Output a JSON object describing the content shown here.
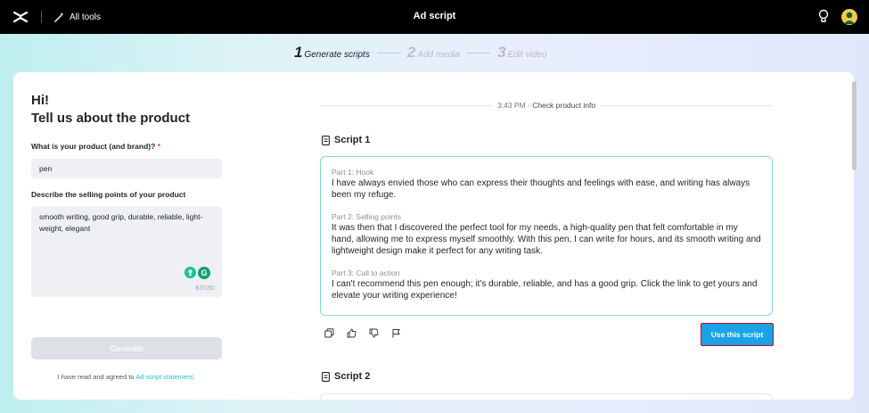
{
  "header": {
    "all_tools_label": "All tools",
    "title": "Ad script"
  },
  "steps": [
    {
      "num": "1",
      "label": "Generate scripts",
      "active": true
    },
    {
      "num": "2",
      "label": "Add media",
      "active": false
    },
    {
      "num": "3",
      "label": "Edit video",
      "active": false
    }
  ],
  "form": {
    "greeting_line1": "Hi!",
    "greeting_line2": "Tell us about the product",
    "product_question": "What is your product (and brand)?",
    "required_mark": "*",
    "product_value": "pen",
    "selling_points_question": "Describe the selling points of your product",
    "selling_points_value": "smooth writing, good grip, durable, reliable, light-weight, elegant",
    "char_count": "67/150",
    "grammarly_letter": "G",
    "generate_label": "Generate",
    "agreement_text": "I have read and agreed to ",
    "agreement_link": "Ad script statement."
  },
  "result": {
    "timestamp": "3:43 PM",
    "separator": "·",
    "status": "Check product info",
    "script1": {
      "title": "Script 1",
      "parts": [
        {
          "label": "Part 1: Hook",
          "text": "I have always envied those who can express their thoughts and feelings with ease, and writing has always been my refuge."
        },
        {
          "label": "Part 2: Selling points",
          "text": "It was then that I discovered the perfect tool for my needs, a high-quality pen that felt comfortable in my hand, allowing me to express myself smoothly. With this pen, I can write for hours, and its smooth writing and lightweight design make it perfect for any writing task."
        },
        {
          "label": "Part 3: Call to action",
          "text": "I can't recommend this pen enough; it's durable, reliable, and has a good grip. Click the link to get yours and elevate your writing experience!"
        }
      ],
      "use_label": "Use this script"
    },
    "script2": {
      "title": "Script 2"
    }
  },
  "colors": {
    "accent": "#1aa2e8",
    "link": "#2bb8c8",
    "script_border": "#7dd8e0",
    "highlight_border": "#d0021b"
  }
}
